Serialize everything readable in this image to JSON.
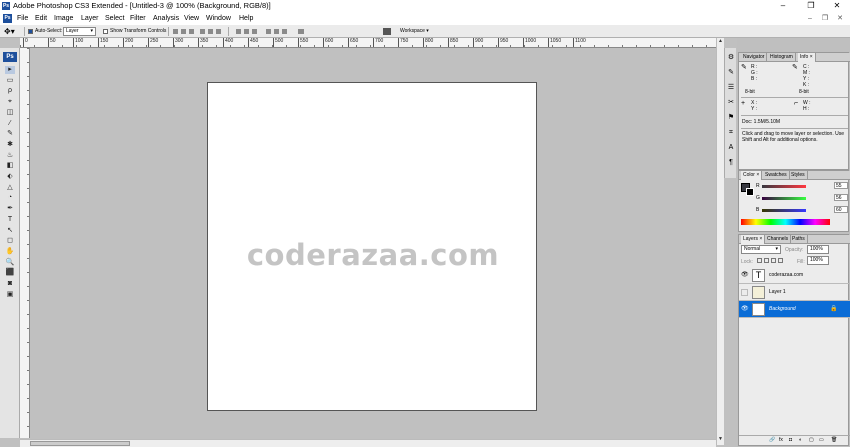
{
  "titlebar": {
    "title": "Adobe Photoshop CS3 Extended - [Untitled-3 @ 100% (Background, RGB/8)]",
    "ps_icon": "Ps",
    "minimize": "–",
    "restore": "❐",
    "close": "✕"
  },
  "menubar": {
    "app_icon": "Ps",
    "items": [
      "File",
      "Edit",
      "Image",
      "Layer",
      "Select",
      "Filter",
      "Analysis",
      "View",
      "Window",
      "Help"
    ],
    "doc_min": "–",
    "doc_restore": "❐",
    "doc_close": "✕"
  },
  "options": {
    "auto_select_label": "Auto-Select:",
    "auto_select_value": "Layer",
    "show_transform_label": "Show Transform Controls",
    "workspace_label": "Workspace ▾"
  },
  "ruler": {
    "labels": [
      "0",
      "50",
      "100",
      "150",
      "200",
      "250",
      "300",
      "350",
      "400",
      "450",
      "500",
      "550",
      "600",
      "650",
      "700",
      "750",
      "800",
      "850",
      "900",
      "950",
      "1000",
      "1050",
      "1100"
    ]
  },
  "toolbox": {
    "logo": "Ps",
    "tools": [
      "▸",
      "▭",
      "ρ",
      "⌖",
      "◫",
      "⁄",
      "✎",
      "✱",
      "♨",
      "◧",
      "⬖",
      "△",
      "◔",
      "✒",
      "T",
      "↖",
      "◻",
      "✋",
      "🔍",
      "⬛",
      "◙",
      "▣"
    ]
  },
  "document": {
    "text": "coderazaa.com"
  },
  "dock": {
    "icons": [
      "⚙",
      "✎",
      "☰",
      "✂",
      "⚑",
      "⌗",
      "A",
      "¶"
    ]
  },
  "info_panel": {
    "tabs": [
      "Navigator",
      "Histogram",
      "Info ×"
    ],
    "r": "R :",
    "g": "G :",
    "b": "B :",
    "c": "C :",
    "m": "M :",
    "y": "Y :",
    "k": "K :",
    "depth_left": "8-bit",
    "depth_right": "8-bit",
    "x": "X :",
    "y2": "Y :",
    "w": "W :",
    "h": "H :",
    "doc": "Doc: 1.5M/5.10M",
    "hint": "Click and drag to move layer or selection.  Use Shift and Alt for additional options."
  },
  "color_panel": {
    "tabs": [
      "Color ×",
      "Swatches",
      "Styles"
    ],
    "channels": [
      {
        "label": "R",
        "value": "55"
      },
      {
        "label": "G",
        "value": "56"
      },
      {
        "label": "B",
        "value": "60"
      }
    ]
  },
  "layers_panel": {
    "tabs": [
      "Layers ×",
      "Channels",
      "Paths"
    ],
    "blend_mode": "Normal",
    "opacity_label": "Opacity:",
    "opacity_value": "100%",
    "lock_label": "Lock:",
    "fill_label": "Fill:",
    "fill_value": "100%",
    "layers": [
      {
        "name": "coderazaa.com",
        "type": "text",
        "visible": true,
        "selected": false
      },
      {
        "name": "Layer 1",
        "type": "image",
        "visible": false,
        "selected": false
      },
      {
        "name": "Background",
        "type": "background",
        "visible": true,
        "selected": true
      }
    ],
    "bottom_icons": [
      "🔗",
      "fx",
      "◘",
      "◐",
      "▢",
      "▭",
      "🗑"
    ]
  },
  "colors": {
    "accent": "#1d4f9c",
    "selection": "#0a6cd6",
    "canvas_bg": "#c0c0c0",
    "doc_text": "#c4c4c4"
  }
}
